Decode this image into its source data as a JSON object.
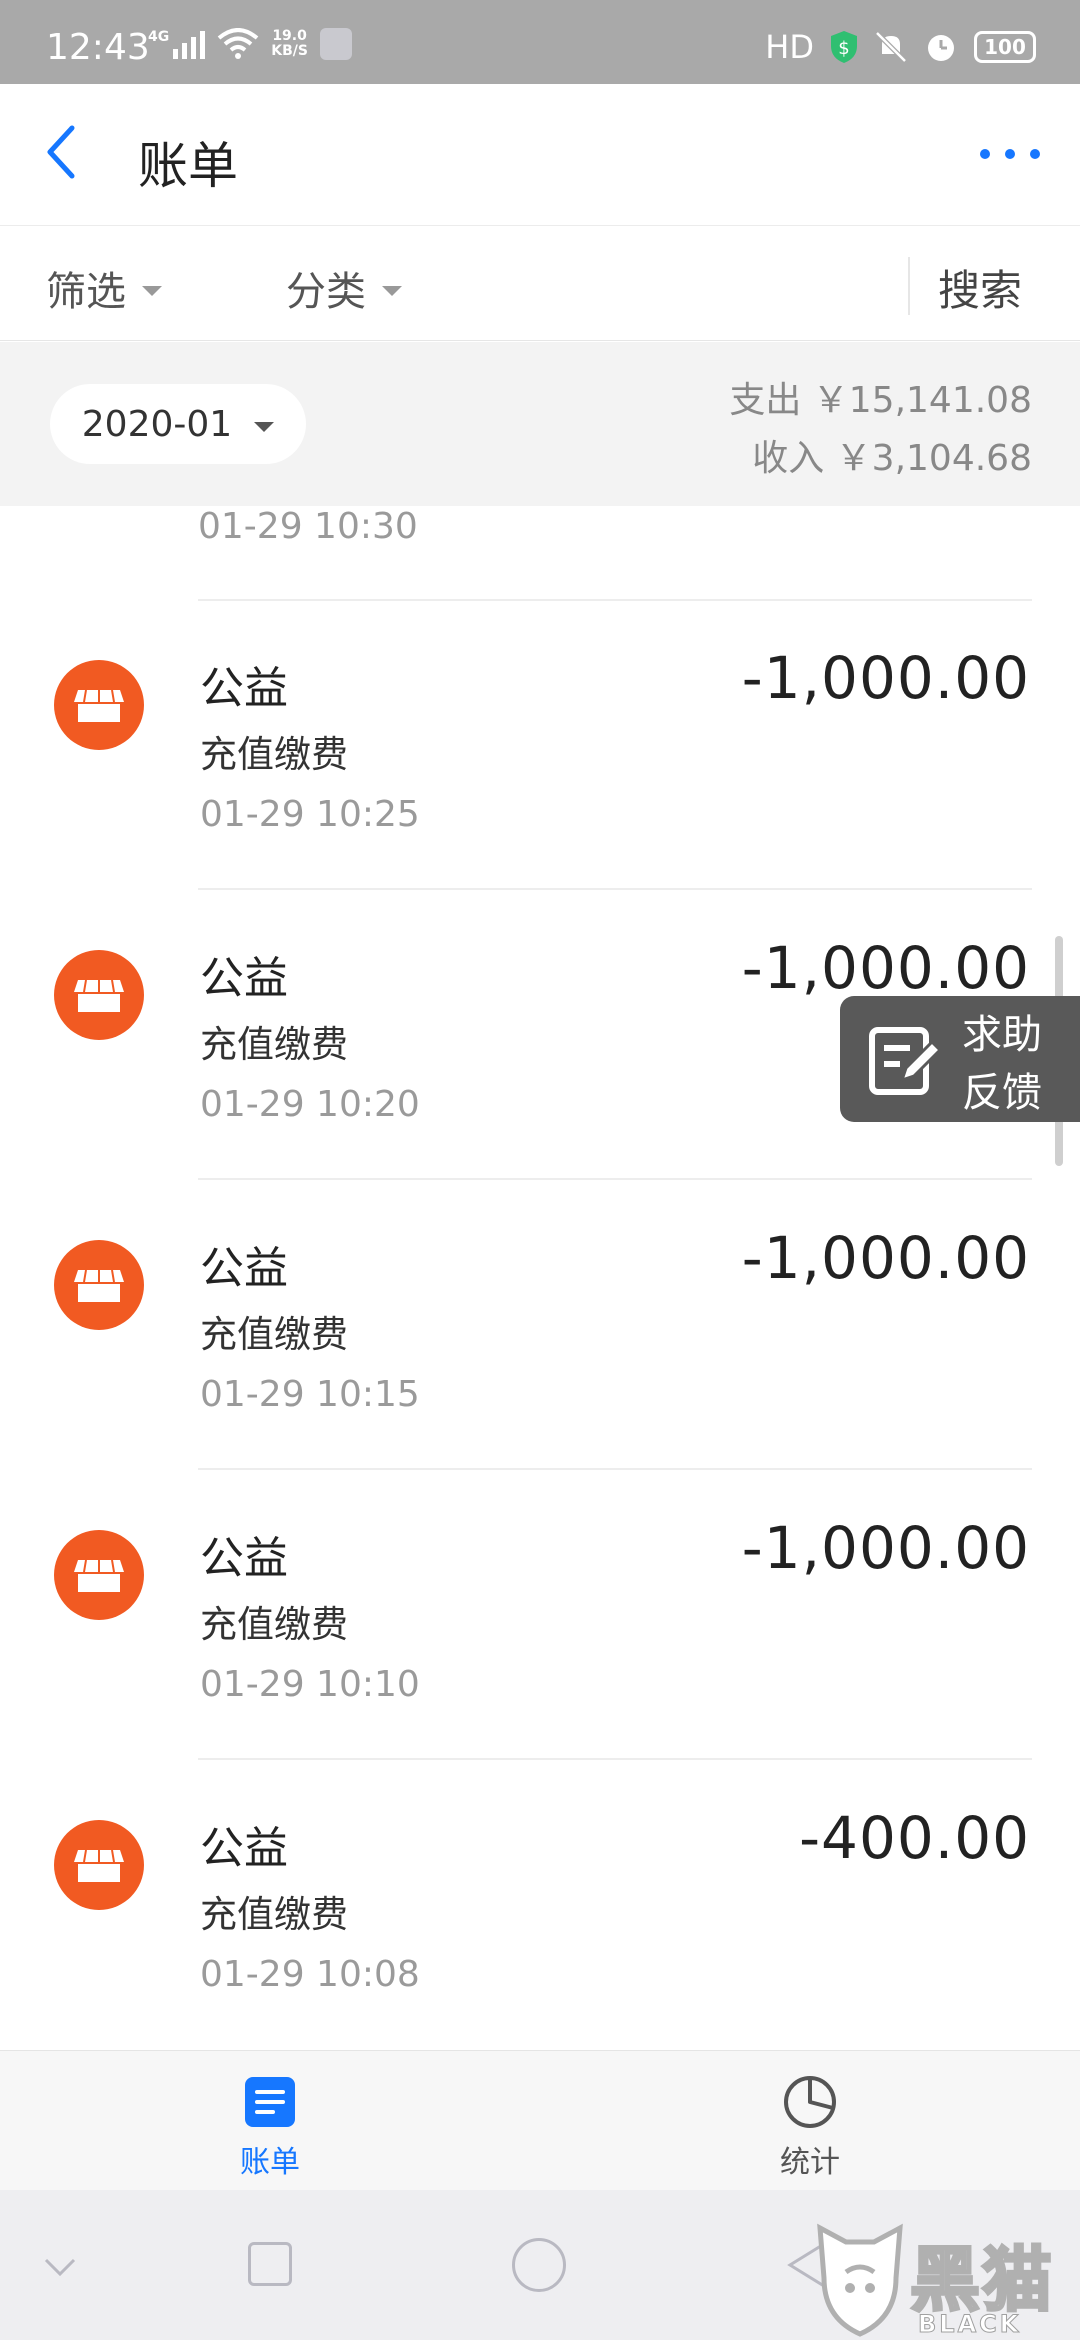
{
  "status_bar": {
    "time": "12:43",
    "network": "4G",
    "speed_value": "19.0",
    "speed_unit": "KB/S",
    "hd": "HD",
    "battery": "100"
  },
  "header": {
    "title": "账单"
  },
  "filters": {
    "filter_label": "筛选",
    "category_label": "分类",
    "search_label": "搜索"
  },
  "month_bar": {
    "month": "2020-01",
    "expense": "支出 ￥15,141.08",
    "income": "收入 ￥3,104.68"
  },
  "list": {
    "partial_time": "01-29  10:30",
    "items": [
      {
        "name": "公益",
        "category": "充值缴费",
        "time": "01-29  10:25",
        "amount": "-1,000.00"
      },
      {
        "name": "公益",
        "category": "充值缴费",
        "time": "01-29  10:20",
        "amount": "-1,000.00"
      },
      {
        "name": "公益",
        "category": "充值缴费",
        "time": "01-29  10:15",
        "amount": "-1,000.00"
      },
      {
        "name": "公益",
        "category": "充值缴费",
        "time": "01-29  10:10",
        "amount": "-1,000.00"
      },
      {
        "name": "公益",
        "category": "充值缴费",
        "time": "01-29  10:08",
        "amount": "-400.00"
      }
    ]
  },
  "feedback": {
    "line1": "求助",
    "line2": "反馈"
  },
  "tabs": [
    {
      "label": "账单",
      "active": true
    },
    {
      "label": "统计",
      "active": false
    }
  ],
  "watermark": {
    "text": "黑猫",
    "sub": "BLACK CAT"
  },
  "colors": {
    "accent": "#1677ff",
    "merchant_icon": "#f15a22",
    "feedback_bg": "#595959"
  },
  "icons": [
    "back-icon",
    "more-icon",
    "store-icon",
    "edit-icon",
    "bill-icon",
    "pie-chart-icon"
  ]
}
